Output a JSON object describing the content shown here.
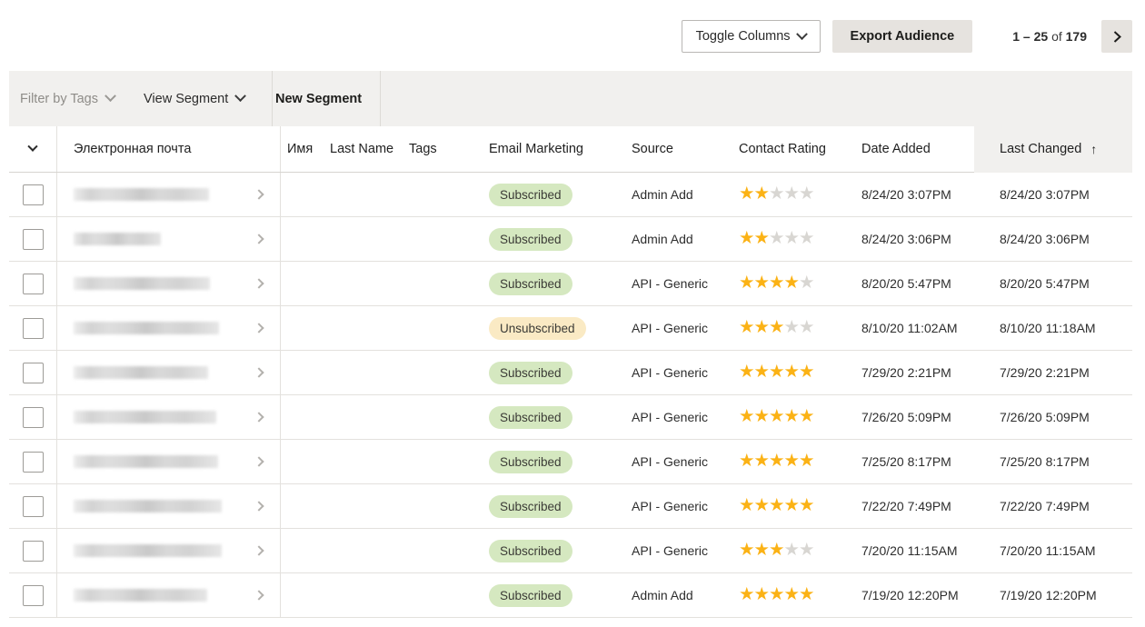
{
  "toolbar": {
    "toggle_columns_label": "Toggle Columns",
    "toggle_columns_icon": "chevron-down-icon",
    "export_audience_label": "Export Audience",
    "pager_range": "1 – 25",
    "pager_of": "of",
    "pager_total": "179",
    "next_page_icon": "chevron-right-icon"
  },
  "filter_bar": {
    "filter_by_tags_label": "Filter by Tags",
    "filter_by_tags_icon": "chevron-down-icon",
    "view_segment_label": "View Segment",
    "view_segment_icon": "chevron-down-icon",
    "new_segment_label": "New Segment"
  },
  "table": {
    "headers": {
      "select_all_icon": "chevron-down-icon",
      "email": "Электронная почта",
      "first_name": "Имя",
      "last_name": "Last Name",
      "tags": "Tags",
      "email_marketing": "Email Marketing",
      "source": "Source",
      "contact_rating": "Contact Rating",
      "date_added": "Date Added",
      "last_changed": "Last Changed",
      "sort_indicator": "↑"
    },
    "rows": [
      {
        "email_blur_width": 149,
        "marketing": "Subscribed",
        "marketing_state": "sub",
        "source": "Admin Add",
        "rating": 2,
        "date_added": "8/24/20 3:07PM",
        "last_changed": "8/24/20 3:07PM"
      },
      {
        "email_blur_width": 96,
        "marketing": "Subscribed",
        "marketing_state": "sub",
        "source": "Admin Add",
        "rating": 2,
        "date_added": "8/24/20 3:06PM",
        "last_changed": "8/24/20 3:06PM"
      },
      {
        "email_blur_width": 150,
        "marketing": "Subscribed",
        "marketing_state": "sub",
        "source": "API - Generic",
        "rating": 4,
        "date_added": "8/20/20 5:47PM",
        "last_changed": "8/20/20 5:47PM"
      },
      {
        "email_blur_width": 160,
        "marketing": "Unsubscribed",
        "marketing_state": "unsub",
        "source": "API - Generic",
        "rating": 3,
        "date_added": "8/10/20 11:02AM",
        "last_changed": "8/10/20 11:18AM"
      },
      {
        "email_blur_width": 148,
        "marketing": "Subscribed",
        "marketing_state": "sub",
        "source": "API - Generic",
        "rating": 5,
        "date_added": "7/29/20 2:21PM",
        "last_changed": "7/29/20 2:21PM"
      },
      {
        "email_blur_width": 157,
        "marketing": "Subscribed",
        "marketing_state": "sub",
        "source": "API - Generic",
        "rating": 5,
        "date_added": "7/26/20 5:09PM",
        "last_changed": "7/26/20 5:09PM"
      },
      {
        "email_blur_width": 159,
        "marketing": "Subscribed",
        "marketing_state": "sub",
        "source": "API - Generic",
        "rating": 5,
        "date_added": "7/25/20 8:17PM",
        "last_changed": "7/25/20 8:17PM"
      },
      {
        "email_blur_width": 163,
        "marketing": "Subscribed",
        "marketing_state": "sub",
        "source": "API - Generic",
        "rating": 5,
        "date_added": "7/22/20 7:49PM",
        "last_changed": "7/22/20 7:49PM"
      },
      {
        "email_blur_width": 163,
        "marketing": "Subscribed",
        "marketing_state": "sub",
        "source": "API - Generic",
        "rating": 3,
        "date_added": "7/20/20 11:15AM",
        "last_changed": "7/20/20 11:15AM"
      },
      {
        "email_blur_width": 147,
        "marketing": "Subscribed",
        "marketing_state": "sub",
        "source": "Admin Add",
        "rating": 5,
        "date_added": "7/19/20 12:20PM",
        "last_changed": "7/19/20 12:20PM"
      }
    ]
  },
  "colors": {
    "subscribed_badge": "#d5e8c0",
    "unsubscribed_badge": "#faeac4",
    "star_filled": "#fbb215",
    "star_empty": "#d8d6d2",
    "filter_bar_bg": "#f1f0ee",
    "button_solid_bg": "#e6e3df"
  }
}
